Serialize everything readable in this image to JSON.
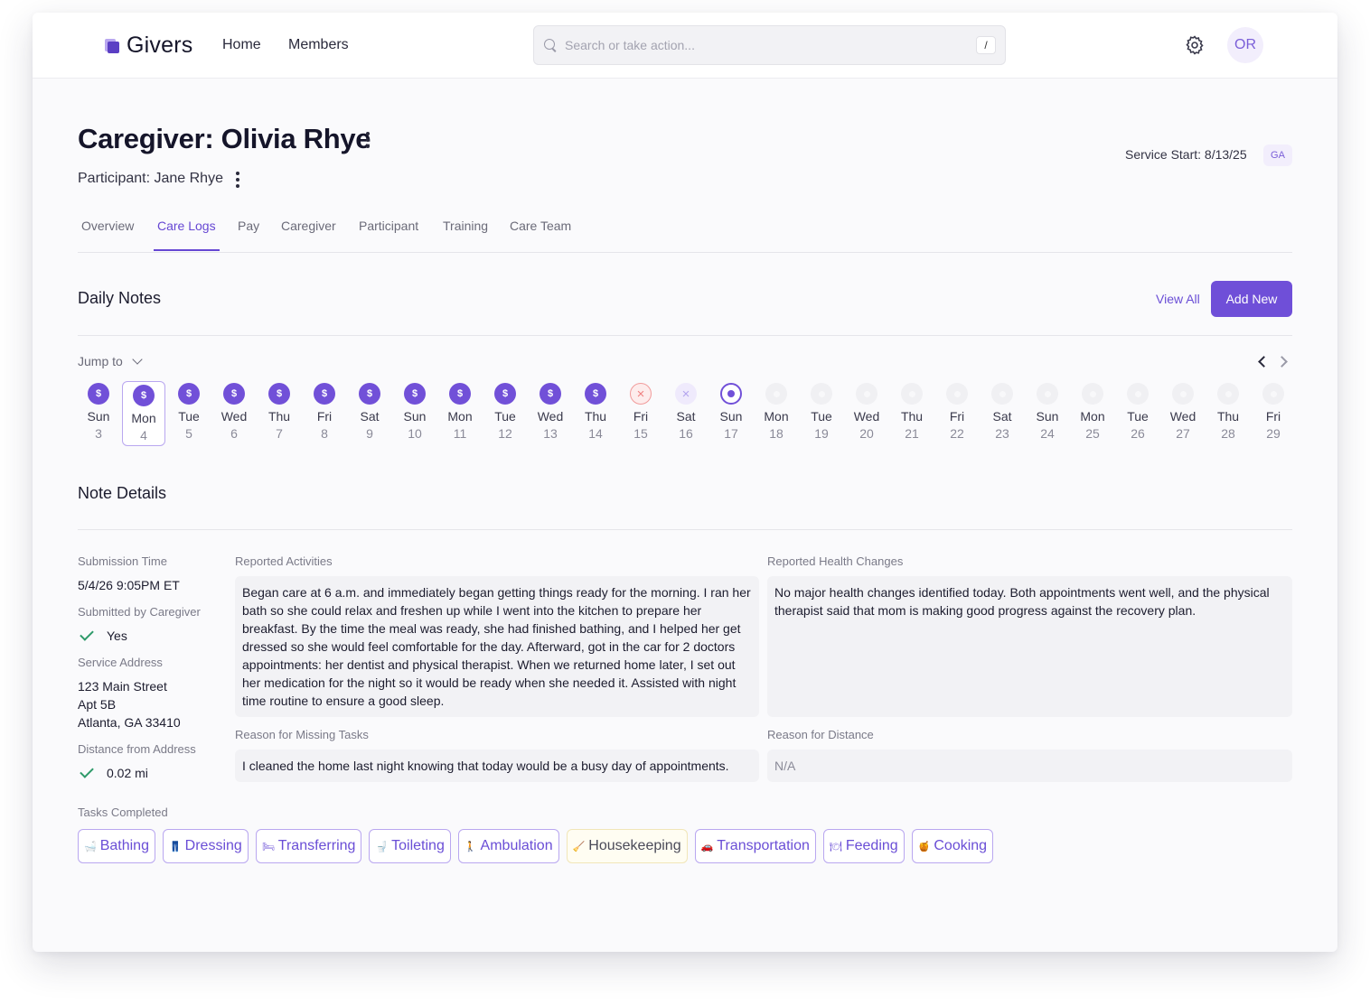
{
  "app": {
    "name": "Givers",
    "nav": [
      "Home",
      "Members"
    ]
  },
  "search": {
    "placeholder": "Search or take action...",
    "shortcut": "/"
  },
  "user": {
    "initials": "OR"
  },
  "header": {
    "title": "Caregiver: Olivia Rhye",
    "participant": "Participant: Jane Rhye",
    "service_start": "Service Start: 8/13/25",
    "state": "GA"
  },
  "tabs": [
    {
      "label": "Overview",
      "active": false
    },
    {
      "label": "Care Logs",
      "active": true
    },
    {
      "label": "Pay",
      "active": false
    },
    {
      "label": "Caregiver",
      "active": false
    },
    {
      "label": "Participant",
      "active": false
    },
    {
      "label": "Training",
      "active": false
    },
    {
      "label": "Care Team",
      "active": false
    }
  ],
  "daily_notes": {
    "title": "Daily Notes",
    "view_all": "View All",
    "add_new": "Add New",
    "jump_to": "Jump to",
    "days": [
      {
        "name": "Sun",
        "num": "3",
        "status": "paid"
      },
      {
        "name": "Mon",
        "num": "4",
        "status": "paid",
        "selected": true
      },
      {
        "name": "Tue",
        "num": "5",
        "status": "paid"
      },
      {
        "name": "Wed",
        "num": "6",
        "status": "paid"
      },
      {
        "name": "Thu",
        "num": "7",
        "status": "paid"
      },
      {
        "name": "Fri",
        "num": "8",
        "status": "paid"
      },
      {
        "name": "Sat",
        "num": "9",
        "status": "paid"
      },
      {
        "name": "Sun",
        "num": "10",
        "status": "paid"
      },
      {
        "name": "Mon",
        "num": "11",
        "status": "paid"
      },
      {
        "name": "Tue",
        "num": "12",
        "status": "paid"
      },
      {
        "name": "Wed",
        "num": "13",
        "status": "paid"
      },
      {
        "name": "Thu",
        "num": "14",
        "status": "paid"
      },
      {
        "name": "Fri",
        "num": "15",
        "status": "missed"
      },
      {
        "name": "Sat",
        "num": "16",
        "status": "off"
      },
      {
        "name": "Sun",
        "num": "17",
        "status": "current"
      },
      {
        "name": "Mon",
        "num": "18",
        "status": "future"
      },
      {
        "name": "Tue",
        "num": "19",
        "status": "future"
      },
      {
        "name": "Wed",
        "num": "20",
        "status": "future"
      },
      {
        "name": "Thu",
        "num": "21",
        "status": "future"
      },
      {
        "name": "Fri",
        "num": "22",
        "status": "future"
      },
      {
        "name": "Sat",
        "num": "23",
        "status": "future"
      },
      {
        "name": "Sun",
        "num": "24",
        "status": "future"
      },
      {
        "name": "Mon",
        "num": "25",
        "status": "future"
      },
      {
        "name": "Tue",
        "num": "26",
        "status": "future"
      },
      {
        "name": "Wed",
        "num": "27",
        "status": "future"
      },
      {
        "name": "Thu",
        "num": "28",
        "status": "future"
      },
      {
        "name": "Fri",
        "num": "29",
        "status": "future"
      }
    ]
  },
  "note_details": {
    "title": "Note Details",
    "submission_time_label": "Submission Time",
    "submission_time": "5/4/26 9:05PM ET",
    "submitted_by_label": "Submitted by Caregiver",
    "submitted_by": "Yes",
    "address_label": "Service Address",
    "address_line1": "123 Main Street",
    "address_line2": "Apt 5B",
    "address_line3": "Atlanta, GA 33410",
    "distance_label": "Distance from Address",
    "distance": "0.02 mi",
    "activities_label": "Reported Activities",
    "activities": "Began care at 6 a.m. and immediately began getting things ready for the morning. I ran her bath so she could relax and freshen up while I went into the kitchen to prepare her breakfast. By the time the meal was ready, she had finished bathing, and I helped her get dressed so she would feel comfortable for the day. Afterward, got in the car for 2 doctors appointments: her dentist and physical therapist. When we returned home later, I set out her medication for the night so it would be ready when she needed it. Assisted with night time routine to ensure a good sleep.",
    "health_label": "Reported Health Changes",
    "health": "No major health changes identified today. Both appointments went well, and the physical therapist said that mom is making good progress against the recovery plan.",
    "missing_label": "Reason for Missing Tasks",
    "missing": "I cleaned the home last night knowing that today would be a busy day of appointments.",
    "distance_reason_label": "Reason for Distance",
    "distance_reason": "N/A",
    "tasks_label": "Tasks Completed",
    "tasks": [
      {
        "icon": "🛁",
        "label": "Bathing"
      },
      {
        "icon": "👖",
        "label": "Dressing"
      },
      {
        "icon": "🛏",
        "label": "Transferring"
      },
      {
        "icon": "🚽",
        "label": "Toileting"
      },
      {
        "icon": "🚶",
        "label": "Ambulation"
      },
      {
        "icon": "🧹",
        "label": "Housekeeping"
      },
      {
        "icon": "🚗",
        "label": "Transportation"
      },
      {
        "icon": "🍽",
        "label": "Feeding"
      },
      {
        "icon": "🍯",
        "label": "Cooking"
      }
    ]
  }
}
